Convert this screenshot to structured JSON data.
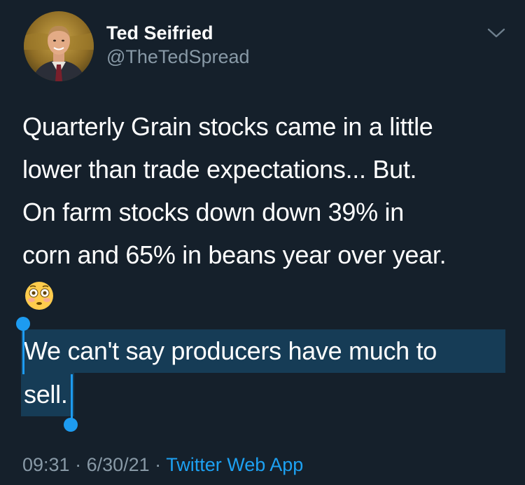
{
  "author": {
    "display_name": "Ted Seifried",
    "handle": "@TheTedSpread"
  },
  "tweet": {
    "lines": [
      "Quarterly Grain stocks came in a little",
      "lower than trade expectations... But.",
      "On farm stocks down down 39% in",
      "corn and 65% in beans year over year."
    ],
    "emoji": "flushed-face-emoji",
    "selected_lines": [
      "We can't say producers have much to",
      "sell."
    ]
  },
  "footer": {
    "time": "09:31",
    "separator_1": " · ",
    "date": "6/30/21",
    "separator_2": " · ",
    "source": "Twitter Web App"
  },
  "colors": {
    "background": "#15202b",
    "text_primary": "#ffffff",
    "text_secondary": "#8899a6",
    "accent": "#1da1f2"
  }
}
